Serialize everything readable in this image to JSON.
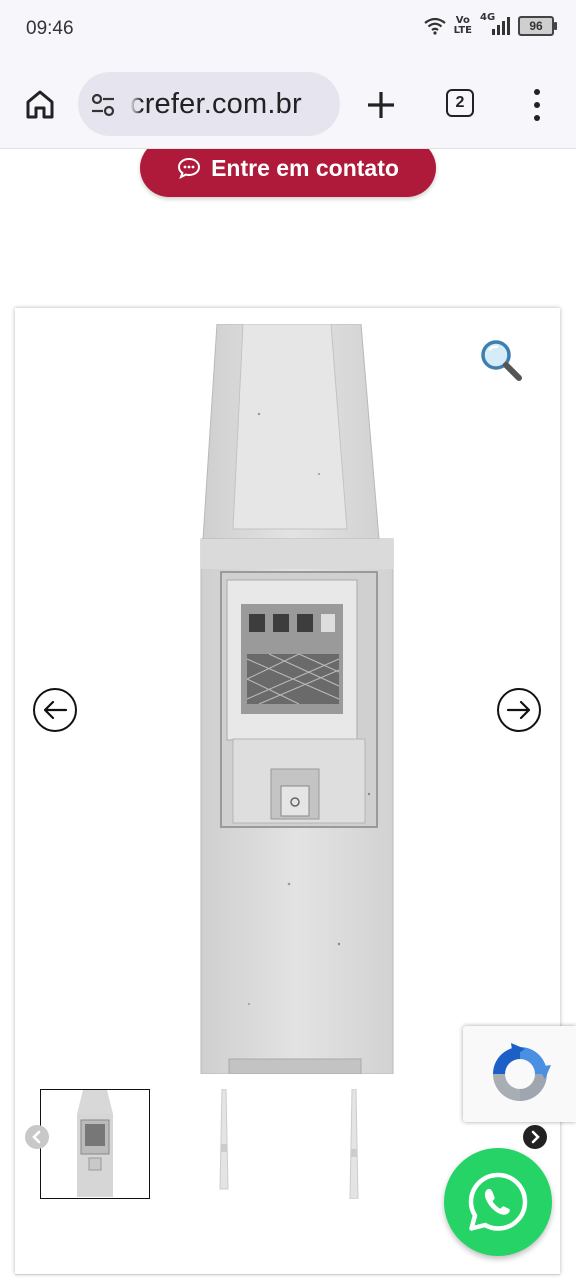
{
  "status_bar": {
    "time": "09:46",
    "network": "4G",
    "volte_top": "Vo",
    "volte_bottom": "LTE",
    "battery": "96",
    "icons": [
      "wifi-icon",
      "volte-icon",
      "signal-icon",
      "battery-icon"
    ]
  },
  "browser": {
    "url": "crefer.com.br",
    "tab_count": "2",
    "icons": [
      "home-icon",
      "site-settings-icon",
      "new-tab-plus-icon",
      "tab-switcher-icon",
      "overflow-menu-icon"
    ]
  },
  "page": {
    "contact_button": "Entre em contato",
    "contact_icon": "chat-bubble-icon",
    "gallery": {
      "thumbnails": [
        "thumb-pole-box",
        "thumb-slim-pole-1",
        "thumb-slim-pole-2"
      ],
      "active_thumbnail": 0
    }
  },
  "colors": {
    "brand": "#b01a3a",
    "whatsapp": "#25d366"
  }
}
